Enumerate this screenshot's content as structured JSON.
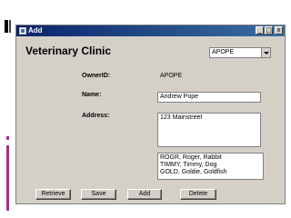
{
  "window": {
    "title": "Add",
    "controls": {
      "minimize": "_",
      "maximize": "□",
      "close": "x"
    }
  },
  "form": {
    "heading": "Veterinary Clinic",
    "owner_select": {
      "value": "APOPE"
    },
    "owner_id": {
      "label": "OwnerID:",
      "value": "APOPE"
    },
    "name": {
      "label": "Name:",
      "value": "Andrew Pope"
    },
    "address": {
      "label": "Address:",
      "value": "123 Mainstreet"
    },
    "pets_list": [
      "ROGR, Roger, Rabbit",
      "TIMMY, Timmy, Dog",
      "GOLD, Goldie, Goldfish"
    ]
  },
  "buttons": {
    "retrieve": "Retrieve",
    "save": "Save",
    "add": "Add",
    "delete": "Delete"
  },
  "icons": {
    "app": "form-window-icon",
    "dropdown": "chevron-down-icon"
  }
}
